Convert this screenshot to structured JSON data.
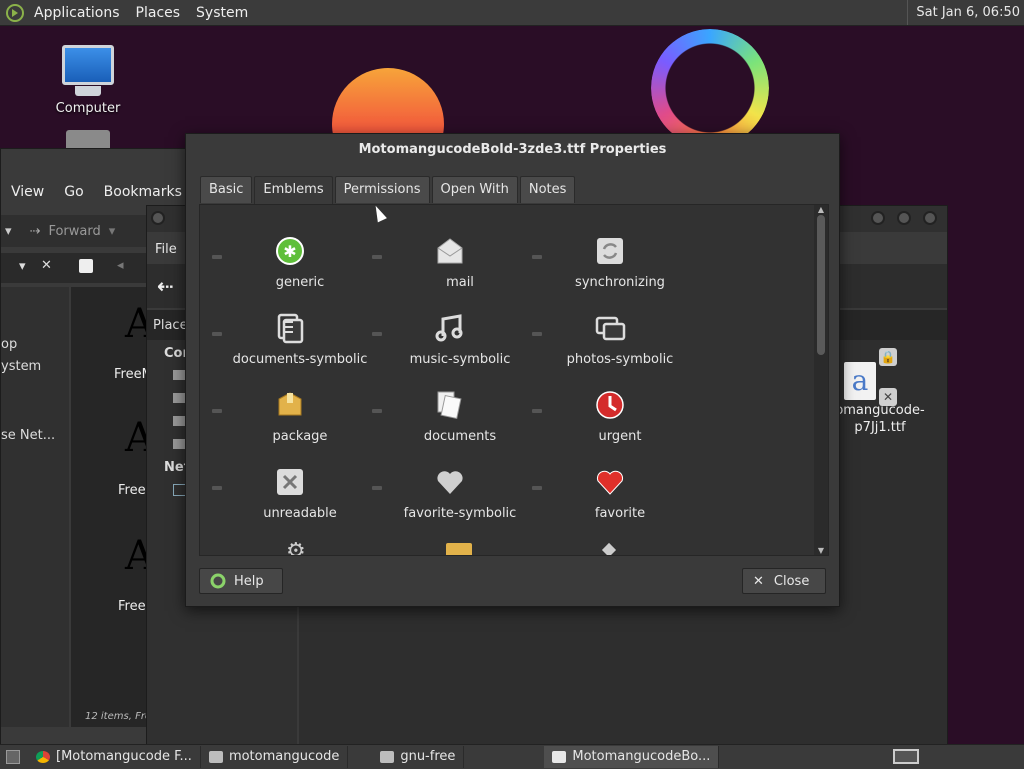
{
  "top_panel": {
    "menus": [
      "Applications",
      "Places",
      "System"
    ],
    "clock": "Sat Jan  6, 06:50"
  },
  "desktop": {
    "icons": [
      {
        "label": "Computer",
        "icon": "computer-icon"
      }
    ]
  },
  "bg_window_a": {
    "menus": [
      "View",
      "Go",
      "Bookmarks"
    ],
    "forward_label": "Forward",
    "sidebar_items": [
      "op",
      "ystem",
      "se Net..."
    ],
    "font_labels": [
      "FreeM",
      "Free",
      "Free"
    ],
    "status": "12 items, Fre"
  },
  "bg_window_b": {
    "menus": [
      "File"
    ],
    "sidebar_headers": [
      "Place",
      "Cor",
      "Net"
    ],
    "file_label_line1": "omangucode-",
    "file_label_line2": "p7Jj1.ttf"
  },
  "dialog": {
    "title": "MotomangucodeBold-3zde3.ttf Properties",
    "tabs": [
      {
        "label": "Basic",
        "active": false
      },
      {
        "label": "Emblems",
        "active": true
      },
      {
        "label": "Permissions",
        "active": false
      },
      {
        "label": "Open With",
        "active": false
      },
      {
        "label": "Notes",
        "active": false
      }
    ],
    "emblems": [
      {
        "label": "generic",
        "icon": "generic-emblem-icon"
      },
      {
        "label": "mail",
        "icon": "mail-icon"
      },
      {
        "label": "synchronizing",
        "icon": "synchronizing-icon"
      },
      {
        "label": "documents-symbolic",
        "icon": "documents-symbolic-icon"
      },
      {
        "label": "music-symbolic",
        "icon": "music-symbolic-icon"
      },
      {
        "label": "photos-symbolic",
        "icon": "photos-symbolic-icon"
      },
      {
        "label": "package",
        "icon": "package-icon"
      },
      {
        "label": "documents",
        "icon": "documents-icon"
      },
      {
        "label": "urgent",
        "icon": "urgent-icon"
      },
      {
        "label": "unreadable",
        "icon": "unreadable-icon"
      },
      {
        "label": "favorite-symbolic",
        "icon": "favorite-symbolic-icon"
      },
      {
        "label": "favorite",
        "icon": "favorite-icon"
      }
    ],
    "help_label": "Help",
    "close_label": "Close"
  },
  "taskbar": {
    "items": [
      {
        "label": "[Motomangucode F...",
        "active": false
      },
      {
        "label": "motomangucode",
        "active": false
      },
      {
        "label": "gnu-free",
        "active": false
      },
      {
        "label": "MotomangucodeBo...",
        "active": true
      }
    ]
  },
  "colors": {
    "desktop_bg": "#2a0d26",
    "panel_bg": "#3b3b3b",
    "dialog_bg": "#3a3a3a",
    "generic_green": "#5fbf3a",
    "urgent_red": "#d42b2b",
    "favorite_red": "#e0302a"
  }
}
